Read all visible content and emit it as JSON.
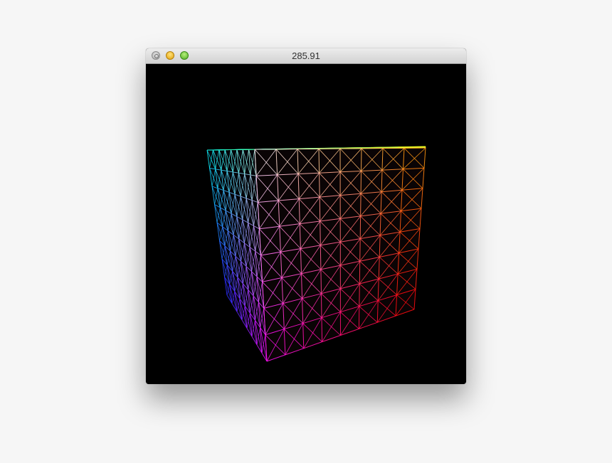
{
  "window": {
    "title": "285.91"
  },
  "controls": {
    "close_icon": "close-icon",
    "minimize_icon": "minimize-icon",
    "zoom_icon": "zoom-icon"
  },
  "scene": {
    "background": "#000000",
    "wire_color": "#ffffff",
    "grid_divisions": 8,
    "face_colors": {
      "front_top_left": "#ffffff",
      "front_top_right": "#ff9a00",
      "front_bottom_left": "#ff00ff",
      "front_bottom_right": "#ff0000",
      "top_back_left": "#00ffff",
      "top_back_right": "#ffff00",
      "left_bottom_back": "#2020ff"
    }
  }
}
